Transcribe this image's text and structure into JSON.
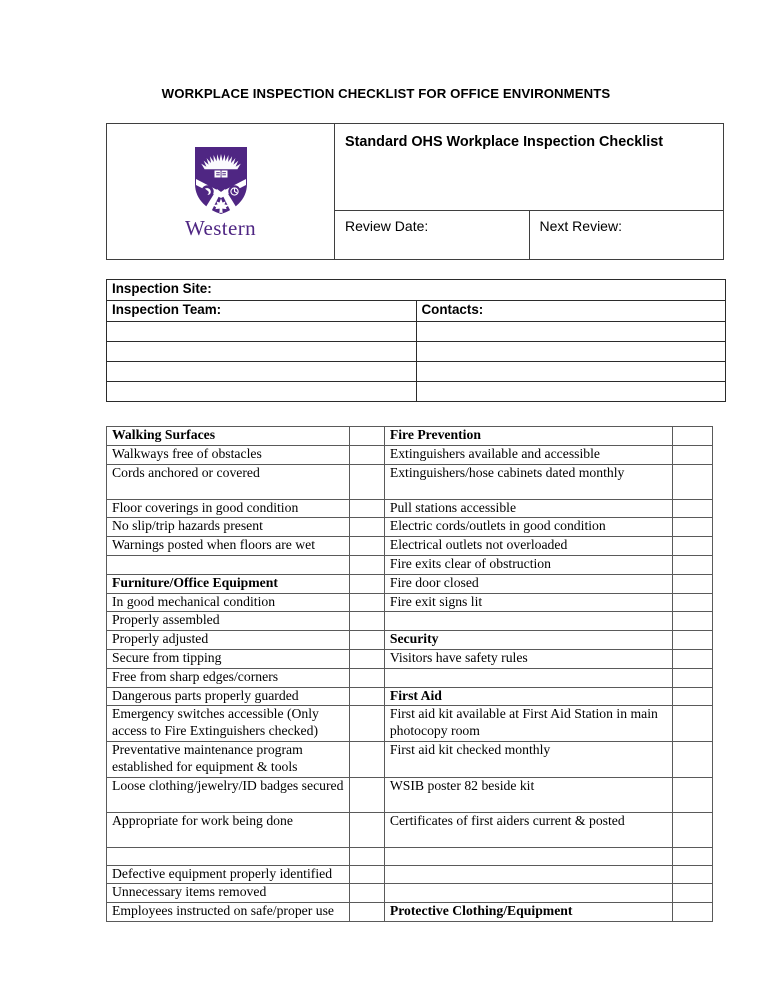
{
  "document": {
    "title": "WORKPLACE INSPECTION CHECKLIST FOR OFFICE ENVIRONMENTS"
  },
  "brand": {
    "name": "Western",
    "logo_icon": "western-shield-icon",
    "purple": "#4F2683"
  },
  "header": {
    "checklist_title": "Standard OHS Workplace Inspection Checklist",
    "review_date_label": "Review Date:",
    "review_date_value": "",
    "next_review_label": "Next Review:",
    "next_review_value": ""
  },
  "info": {
    "inspection_site_label": "Inspection Site:",
    "inspection_site_value": "",
    "inspection_team_label": "Inspection Team:",
    "contacts_label": "Contacts:",
    "team_rows": [
      {
        "team": "",
        "contact": ""
      },
      {
        "team": "",
        "contact": ""
      },
      {
        "team": "",
        "contact": ""
      },
      {
        "team": "",
        "contact": ""
      }
    ]
  },
  "checklist": {
    "rows": [
      {
        "left": "Walking Surfaces",
        "left_head": true,
        "left_check": "",
        "right": "Fire Prevention",
        "right_head": true,
        "right_check": "",
        "height": "r1"
      },
      {
        "left": "Walkways free of obstacles",
        "left_head": false,
        "left_check": "",
        "right": "Extinguishers available and accessible",
        "right_head": false,
        "right_check": "",
        "height": "r1"
      },
      {
        "left": "Cords anchored or covered",
        "left_head": false,
        "left_check": "",
        "right": "Extinguishers/hose cabinets dated monthly",
        "right_head": false,
        "right_check": "",
        "height": "r2"
      },
      {
        "left": "Floor coverings in good condition",
        "left_head": false,
        "left_check": "",
        "right": "Pull stations accessible",
        "right_head": false,
        "right_check": "",
        "height": "r1"
      },
      {
        "left": "No slip/trip hazards present",
        "left_head": false,
        "left_check": "",
        "right": "Electric cords/outlets in good condition",
        "right_head": false,
        "right_check": "",
        "height": "r1"
      },
      {
        "left": "Warnings posted when floors are wet",
        "left_head": false,
        "left_check": "",
        "right": "Electrical outlets not overloaded",
        "right_head": false,
        "right_check": "",
        "height": "r1"
      },
      {
        "left": "",
        "left_head": false,
        "left_check": "",
        "right": "Fire exits clear of obstruction",
        "right_head": false,
        "right_check": "",
        "height": "r1"
      },
      {
        "left": "Furniture/Office Equipment",
        "left_head": true,
        "left_check": "",
        "right": "Fire door closed",
        "right_head": false,
        "right_check": "",
        "height": "r1"
      },
      {
        "left": "In good mechanical condition",
        "left_head": false,
        "left_check": "",
        "right": "Fire exit signs lit",
        "right_head": false,
        "right_check": "",
        "height": "r1"
      },
      {
        "left": "Properly assembled",
        "left_head": false,
        "left_check": "",
        "right": "",
        "right_head": false,
        "right_check": "",
        "height": "r1"
      },
      {
        "left": "Properly adjusted",
        "left_head": false,
        "left_check": "",
        "right": "Security",
        "right_head": true,
        "right_check": "",
        "height": "r1"
      },
      {
        "left": "Secure from tipping",
        "left_head": false,
        "left_check": "",
        "right": "Visitors have safety rules",
        "right_head": false,
        "right_check": "",
        "height": "r1"
      },
      {
        "left": "Free from sharp edges/corners",
        "left_head": false,
        "left_check": "",
        "right": "",
        "right_head": false,
        "right_check": "",
        "height": "r1"
      },
      {
        "left": "Dangerous parts properly guarded",
        "left_head": false,
        "left_check": "",
        "right": "First Aid",
        "right_head": true,
        "right_check": "",
        "height": "r1"
      },
      {
        "left": "Emergency switches accessible (Only access to Fire Extinguishers checked)",
        "left_head": false,
        "left_check": "",
        "right": "First aid kit available at First Aid Station in main photocopy room",
        "right_head": false,
        "right_check": "",
        "height": "r2"
      },
      {
        "left": "Preventative maintenance program established for equipment & tools",
        "left_head": false,
        "left_check": "",
        "right": "First aid kit checked monthly",
        "right_head": false,
        "right_check": "",
        "height": "r2"
      },
      {
        "left": "Loose clothing/jewelry/ID badges secured",
        "left_head": false,
        "left_check": "",
        "right": "WSIB poster 82 beside kit",
        "right_head": false,
        "right_check": "",
        "height": "r2"
      },
      {
        "left": "Appropriate for work being done",
        "left_head": false,
        "left_check": "",
        "right": "Certificates of first aiders current & posted",
        "right_head": false,
        "right_check": "",
        "height": "r2"
      },
      {
        "left": "",
        "left_head": false,
        "left_check": "",
        "right": "",
        "right_head": false,
        "right_check": "",
        "height": "r1"
      },
      {
        "left": "Defective equipment properly identified",
        "left_head": false,
        "left_check": "",
        "right": "",
        "right_head": false,
        "right_check": "",
        "height": "r1"
      },
      {
        "left": "Unnecessary items removed",
        "left_head": false,
        "left_check": "",
        "right": "",
        "right_head": false,
        "right_check": "",
        "height": "r1"
      },
      {
        "left": "Employees instructed on safe/proper use",
        "left_head": false,
        "left_check": "",
        "right": "Protective Clothing/Equipment",
        "right_head": true,
        "right_check": "",
        "height": "r1"
      }
    ]
  }
}
